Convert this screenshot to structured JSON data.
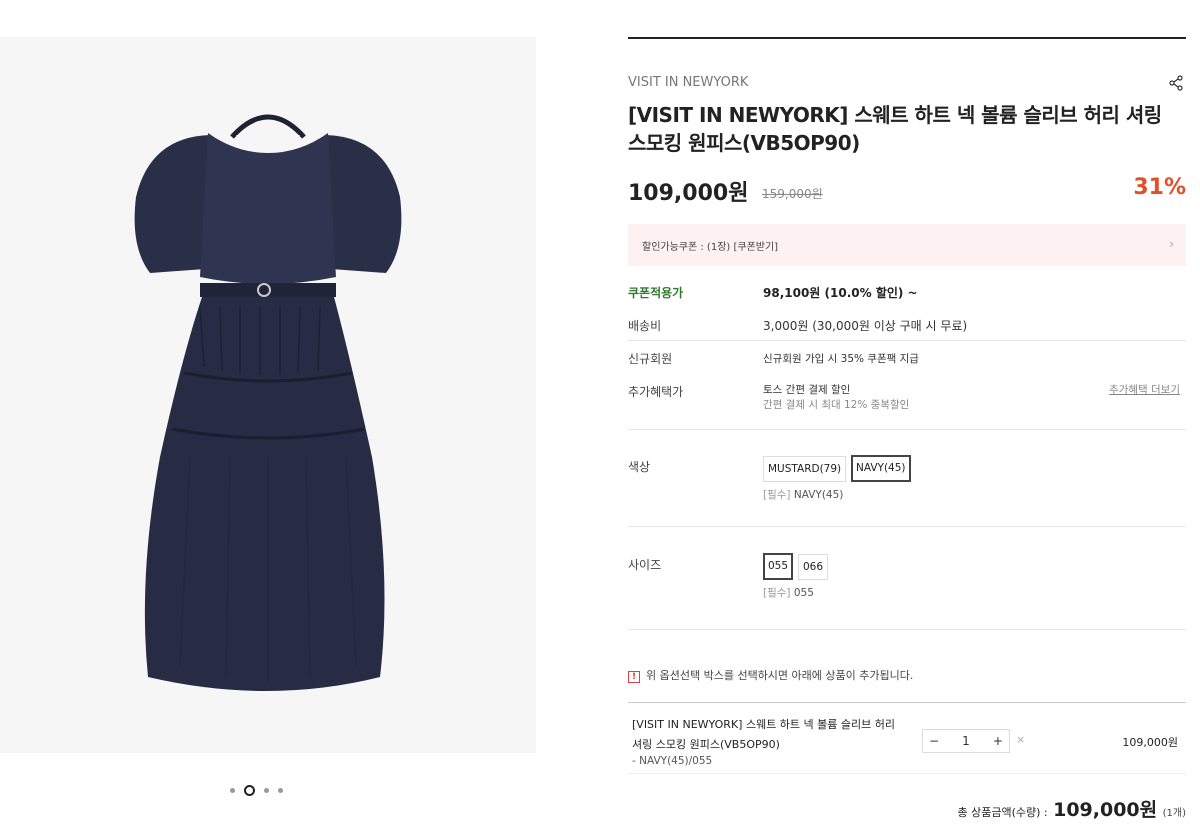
{
  "gallery": {
    "image_alt": "navy midi dress product photo",
    "slide_count": 4,
    "active_index": 1
  },
  "product": {
    "brand": "VISIT IN NEWYORK",
    "title": "[VISIT IN NEWYORK] 스웨트 하트 넥 볼륨 슬리브 허리 셔링 스모킹 원피스(VB5OP90)",
    "price": "109,000원",
    "original_price": "159,000원",
    "discount_rate": "31%"
  },
  "coupon_banner": {
    "text": "할인가능쿠폰 : (1장) [쿠폰받기]"
  },
  "info": {
    "coupon_label": "쿠폰적용가",
    "coupon_value": "98,100원 (10.0% 할인) ~",
    "shipping_label": "배송비",
    "shipping_value": "3,000원 (30,000원 이상 구매 시 무료)",
    "new_member_label": "신규회원",
    "new_member_value": "신규회원 가입 시 35% 쿠폰팩 지급",
    "extra_label": "추가혜택가",
    "extra_value1": "토스 간편 결제 할인",
    "extra_value2": "간편 결제 시 최대 12% 중복할인",
    "extra_more": "추가혜택 더보기"
  },
  "color_option": {
    "label": "색상",
    "options": [
      "MUSTARD(79)",
      "NAVY(45)"
    ],
    "selected": "NAVY(45)",
    "required_prefix": "[필수]",
    "required_value": "NAVY(45)"
  },
  "size_option": {
    "label": "사이즈",
    "options": [
      "055",
      "066"
    ],
    "selected": "055",
    "required_prefix": "[필수]",
    "required_value": "055"
  },
  "notice": {
    "mark": "!",
    "text": "위 옵션선택 박스를 선택하시면 아래에 상품이 추가됩니다."
  },
  "selected_item": {
    "name_line1": "[VISIT IN NEWYORK] 스웨트 하트 넥 볼륨 슬리브 허리",
    "name_line2": "셔링 스모킹 원피스(VB5OP90)",
    "option": "- NAVY(45)/055",
    "quantity": "1",
    "minus": "−",
    "plus": "+",
    "remove": "×",
    "price": "109,000원"
  },
  "total": {
    "label": "총 상품금액(수량) :",
    "amount": "109,000원",
    "count": "(1개)"
  }
}
